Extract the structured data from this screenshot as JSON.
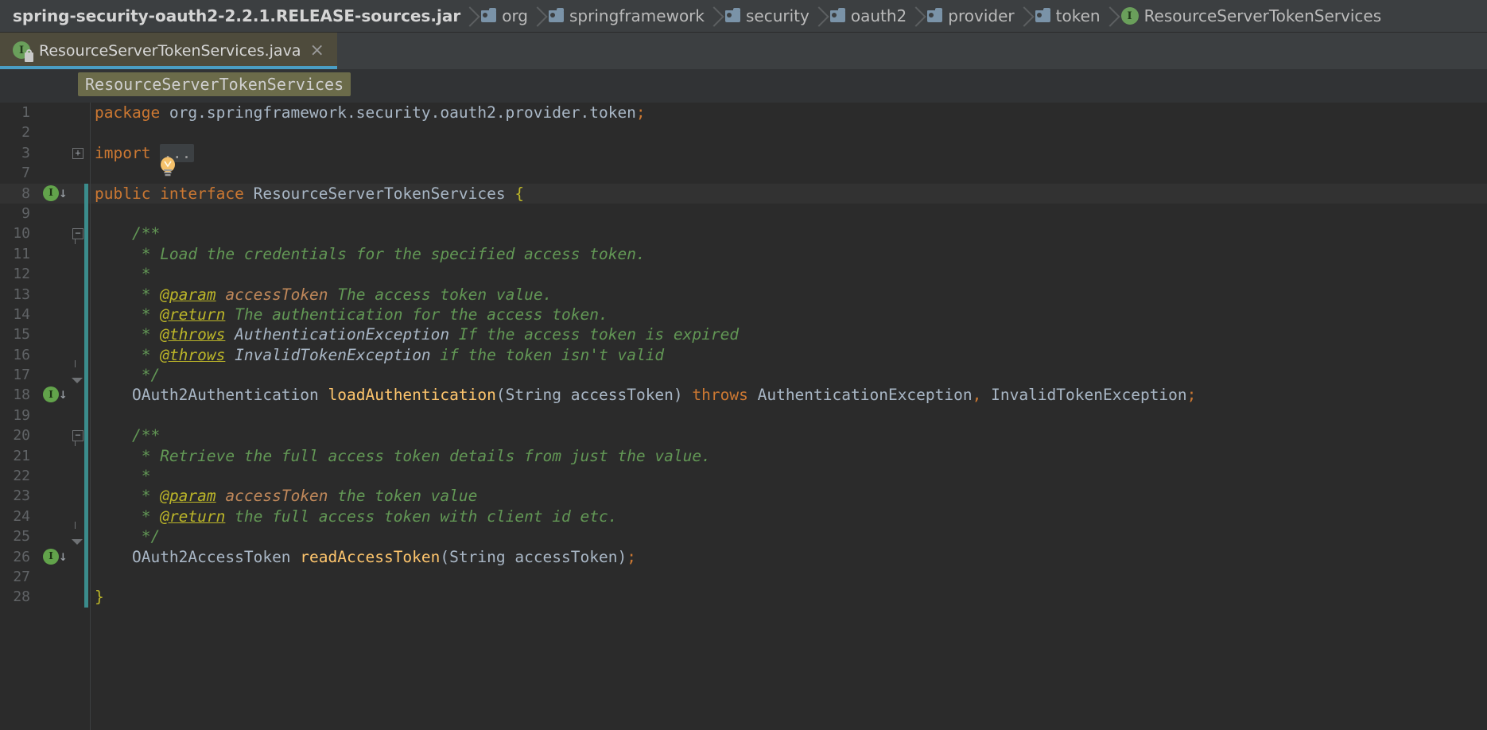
{
  "navbar": {
    "crumbs": [
      {
        "label": "spring-security-oauth2-2.2.1.RELEASE-sources.jar",
        "icon": "jar-icon",
        "kind": "jar"
      },
      {
        "label": "org",
        "icon": "folder-icon",
        "kind": "folder"
      },
      {
        "label": "springframework",
        "icon": "folder-icon",
        "kind": "folder"
      },
      {
        "label": "security",
        "icon": "folder-icon",
        "kind": "folder"
      },
      {
        "label": "oauth2",
        "icon": "folder-icon",
        "kind": "folder"
      },
      {
        "label": "provider",
        "icon": "folder-icon",
        "kind": "folder"
      },
      {
        "label": "token",
        "icon": "folder-icon",
        "kind": "folder"
      },
      {
        "label": "ResourceServerTokenServices",
        "icon": "interface-icon",
        "kind": "interface",
        "icon_letter": "I"
      }
    ]
  },
  "tab": {
    "label": "ResourceServerTokenServices.java",
    "icon": "interface-icon",
    "icon_letter": "I",
    "badge": "lock-icon",
    "close_label": "×",
    "active_underline_color": "#4a9ec4",
    "background_color": "#4e4b3c"
  },
  "sticky_breadcrumb": {
    "label": "ResourceServerTokenServices"
  },
  "theme": {
    "editor_background": "#2b2b2b",
    "gutter_text": "#606366",
    "keyword": "#cc7832",
    "comment": "#629755",
    "javadoc_tag": "#bbb529",
    "javadoc_param": "#c0885a",
    "method_name": "#ffc66d",
    "default_text": "#a9b7c6",
    "caret_row": "#323232",
    "vcs_modified": "#3b8c8c"
  },
  "editor": {
    "lines": [
      {
        "num": "1",
        "indent": 0,
        "tokens": [
          {
            "t": "package ",
            "c": "kw"
          },
          {
            "t": "org.springframework.security.oauth2.provider.token",
            "c": "plain"
          },
          {
            "t": ";",
            "c": "semi"
          }
        ]
      },
      {
        "num": "2",
        "indent": 0,
        "tokens": []
      },
      {
        "num": "3",
        "indent": 0,
        "fold": "plus",
        "tokens": [
          {
            "t": "import ",
            "c": "kw"
          },
          {
            "t": "...",
            "c": "ellipsis"
          }
        ]
      },
      {
        "num": "7",
        "indent": 0,
        "bulb": true,
        "tokens": []
      },
      {
        "num": "8",
        "indent": 0,
        "highlight": true,
        "impl": true,
        "vcs": true,
        "tokens": [
          {
            "t": "public ",
            "c": "kw"
          },
          {
            "t": "interface ",
            "c": "kw"
          },
          {
            "t": "ResourceServerTokenServices ",
            "c": "type"
          },
          {
            "t": "{",
            "c": "brace"
          }
        ]
      },
      {
        "num": "9",
        "indent": 0,
        "vcs": true,
        "tokens": []
      },
      {
        "num": "10",
        "indent": 1,
        "fold": "start",
        "vcs": true,
        "tokens": [
          {
            "t": "/**",
            "c": "cmt"
          }
        ]
      },
      {
        "num": "11",
        "indent": 1,
        "vcs": true,
        "tokens": [
          {
            "t": " * Load the credentials for the specified access token.",
            "c": "cmt"
          }
        ]
      },
      {
        "num": "12",
        "indent": 1,
        "vcs": true,
        "tokens": [
          {
            "t": " *",
            "c": "cmt"
          }
        ]
      },
      {
        "num": "13",
        "indent": 1,
        "vcs": true,
        "tokens": [
          {
            "t": " * ",
            "c": "cmt"
          },
          {
            "t": "@param",
            "c": "tag"
          },
          {
            "t": " accessToken",
            "c": "pname"
          },
          {
            "t": " The access token value.",
            "c": "cmt"
          }
        ]
      },
      {
        "num": "14",
        "indent": 1,
        "vcs": true,
        "tokens": [
          {
            "t": " * ",
            "c": "cmt"
          },
          {
            "t": "@return",
            "c": "tag"
          },
          {
            "t": " The authentication for the access token.",
            "c": "cmt"
          }
        ]
      },
      {
        "num": "15",
        "indent": 1,
        "vcs": true,
        "tokens": [
          {
            "t": " * ",
            "c": "cmt"
          },
          {
            "t": "@throws",
            "c": "tag"
          },
          {
            "t": " AuthenticationException",
            "c": "ctype"
          },
          {
            "t": " If the access token is expired",
            "c": "cmt"
          }
        ]
      },
      {
        "num": "16",
        "indent": 1,
        "vcs": true,
        "tokens": [
          {
            "t": " * ",
            "c": "cmt"
          },
          {
            "t": "@throws",
            "c": "tag"
          },
          {
            "t": " InvalidTokenException",
            "c": "ctype"
          },
          {
            "t": " if the token isn't valid",
            "c": "cmt"
          }
        ]
      },
      {
        "num": "17",
        "indent": 1,
        "fold": "end",
        "vcs": true,
        "tokens": [
          {
            "t": " */",
            "c": "cmt"
          }
        ]
      },
      {
        "num": "18",
        "indent": 1,
        "impl": true,
        "vcs": true,
        "tokens": [
          {
            "t": "OAuth2Authentication ",
            "c": "type"
          },
          {
            "t": "loadAuthentication",
            "c": "mname"
          },
          {
            "t": "(",
            "c": "plain"
          },
          {
            "t": "String accessToken",
            "c": "type"
          },
          {
            "t": ") ",
            "c": "plain"
          },
          {
            "t": "throws ",
            "c": "kw"
          },
          {
            "t": "AuthenticationException",
            "c": "type"
          },
          {
            "t": ",",
            "c": "semi"
          },
          {
            "t": " InvalidTokenException",
            "c": "type"
          },
          {
            "t": ";",
            "c": "semi"
          }
        ]
      },
      {
        "num": "19",
        "indent": 0,
        "vcs": true,
        "tokens": []
      },
      {
        "num": "20",
        "indent": 1,
        "fold": "start",
        "vcs": true,
        "tokens": [
          {
            "t": "/**",
            "c": "cmt"
          }
        ]
      },
      {
        "num": "21",
        "indent": 1,
        "vcs": true,
        "tokens": [
          {
            "t": " * Retrieve the full access token details from just the value.",
            "c": "cmt"
          }
        ]
      },
      {
        "num": "22",
        "indent": 1,
        "vcs": true,
        "tokens": [
          {
            "t": " *",
            "c": "cmt"
          }
        ]
      },
      {
        "num": "23",
        "indent": 1,
        "vcs": true,
        "tokens": [
          {
            "t": " * ",
            "c": "cmt"
          },
          {
            "t": "@param",
            "c": "tag"
          },
          {
            "t": " accessToken",
            "c": "pname"
          },
          {
            "t": " the token value",
            "c": "cmt"
          }
        ]
      },
      {
        "num": "24",
        "indent": 1,
        "vcs": true,
        "tokens": [
          {
            "t": " * ",
            "c": "cmt"
          },
          {
            "t": "@return",
            "c": "tag"
          },
          {
            "t": " the full access token with client id etc.",
            "c": "cmt"
          }
        ]
      },
      {
        "num": "25",
        "indent": 1,
        "fold": "end",
        "vcs": true,
        "tokens": [
          {
            "t": " */",
            "c": "cmt"
          }
        ]
      },
      {
        "num": "26",
        "indent": 1,
        "impl": true,
        "vcs": true,
        "tokens": [
          {
            "t": "OAuth2AccessToken ",
            "c": "type"
          },
          {
            "t": "readAccessToken",
            "c": "mname"
          },
          {
            "t": "(",
            "c": "plain"
          },
          {
            "t": "String accessToken",
            "c": "type"
          },
          {
            "t": ")",
            "c": "plain"
          },
          {
            "t": ";",
            "c": "semi"
          }
        ]
      },
      {
        "num": "27",
        "indent": 0,
        "vcs": true,
        "tokens": []
      },
      {
        "num": "28",
        "indent": 0,
        "vcs": true,
        "tokens": [
          {
            "t": "}",
            "c": "brace"
          }
        ]
      }
    ]
  }
}
